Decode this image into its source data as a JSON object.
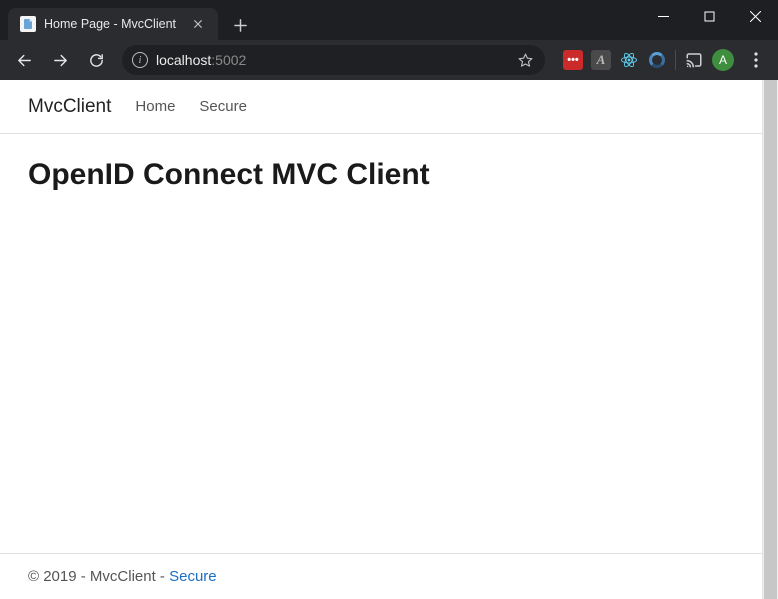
{
  "window": {
    "tab_title": "Home Page - MvcClient"
  },
  "address": {
    "host": "localhost",
    "port": ":5002"
  },
  "profile": {
    "avatar_letter": "A"
  },
  "extensions": {
    "red_label": "•••",
    "adobe_label": "A"
  },
  "page": {
    "brand": "MvcClient",
    "nav": {
      "home": "Home",
      "secure": "Secure"
    },
    "heading": "OpenID Connect MVC Client",
    "footer": {
      "copyright": "© 2019 - MvcClient - ",
      "secure_link": "Secure"
    }
  }
}
